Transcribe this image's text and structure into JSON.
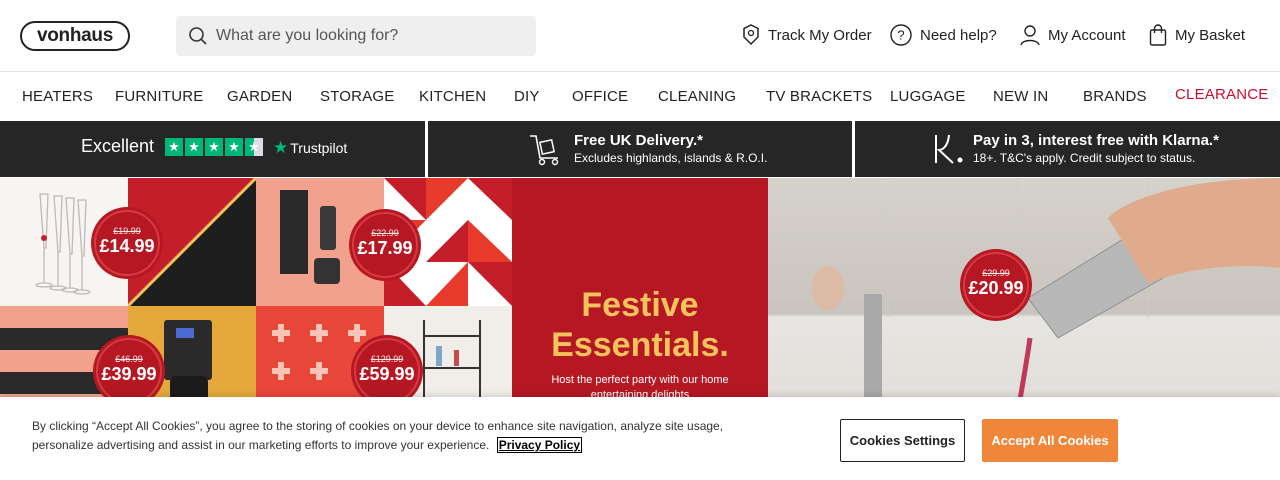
{
  "header": {
    "logo": "vonhaus",
    "search_placeholder": "What are you looking for?",
    "links": {
      "track": "Track My Order",
      "help": "Need help?",
      "account": "My Account",
      "basket": "My Basket"
    }
  },
  "nav": {
    "items": [
      "HEATERS",
      "FURNITURE",
      "GARDEN",
      "STORAGE",
      "KITCHEN",
      "DIY",
      "OFFICE",
      "CLEANING",
      "TV BRACKETS",
      "LUGGAGE",
      "NEW IN",
      "BRANDS",
      "CLEARANCE"
    ]
  },
  "usp": {
    "trustpilot": {
      "rating_word": "Excellent",
      "brand": "Trustpilot",
      "stars": 4.5
    },
    "delivery": {
      "title": "Free UK Delivery.*",
      "sub": "Excludes highlands, islands & R.O.I."
    },
    "klarna": {
      "title": "Pay in 3, interest free with Klarna.*",
      "sub": "18+. T&C's apply. Credit subject to status."
    }
  },
  "banner": {
    "title_line1": "Festive",
    "title_line2": "Essentials.",
    "subtitle": "Host the perfect party with our home entertaining delights",
    "prices": [
      {
        "was": "£19.99",
        "now": "£14.99"
      },
      {
        "was": "£22.99",
        "now": "£17.99"
      },
      {
        "was": "£46.99",
        "now": "£39.99"
      },
      {
        "was": "£129.99",
        "now": "£59.99"
      },
      {
        "was": "£29.99",
        "now": "£20.99"
      }
    ]
  },
  "cookie": {
    "text": "By clicking “Accept All Cookies”, you agree to the storing of cookies on your device to enhance site navigation, analyze site usage, personalize advertising and assist in our marketing efforts to improve your experience.",
    "policy_link": "Privacy Policy",
    "settings_label": "Cookies Settings",
    "accept_label": "Accept All Cookies"
  },
  "colors": {
    "accent_orange": "#f0863a",
    "clearance_red": "#c8102e",
    "trustpilot_green": "#00b67a",
    "usp_bar": "#262626",
    "banner_red": "#b51823",
    "festive_gold": "#f3c35c"
  }
}
